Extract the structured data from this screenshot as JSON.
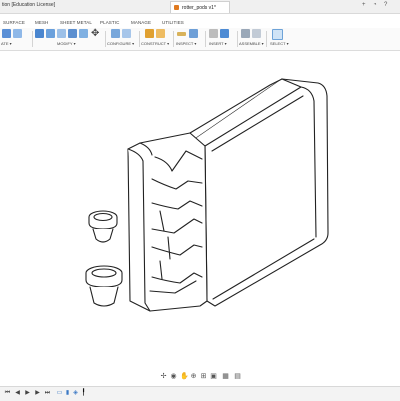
{
  "window": {
    "app_title": "tion [Education License]",
    "doc_tab": "rotter_pods v1*",
    "help": "?"
  },
  "tabs": [
    "SURFACE",
    "MESH",
    "SHEET METAL",
    "PLASTIC",
    "MANAGE",
    "UTILITIES"
  ],
  "toolbar": {
    "groups": [
      "ATE ▾",
      "MODIFY ▾",
      "CONFIGURE ▾",
      "CONSTRUCT ▾",
      "INSPECT ▾",
      "INSERT ▾",
      "ASSEMBLE ▾",
      "SELECT ▾"
    ]
  },
  "colors": {
    "accent": "#0a6fc2",
    "model_line": "#222222",
    "model_fill": "#ffffff"
  }
}
